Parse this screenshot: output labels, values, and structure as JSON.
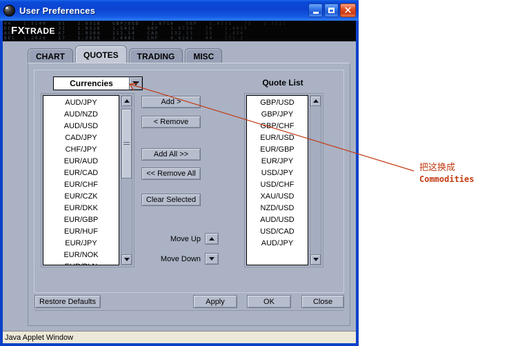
{
  "window": {
    "title": "User Preferences",
    "icon": "app-sphere-icon",
    "buttons": {
      "minimize": "_",
      "maximize": "□",
      "close": "✕"
    }
  },
  "banner": {
    "logo_main": "FX",
    "logo_rest": "TRADE",
    "ticker_noise": "04   1.5140   55   1.0318   GBP/USD   1.8716   GBP   1.6731   73   2.3111\nDEM  1.2140   32   1.0318   1.5416   GBP   1.0736   78   1.4019\nAU   1.2135   67   1.0304   111.14   CAD   132.13   23   1.434\nBEL  1.2026   17   1.2036   1.6401   CHF   0.6161   44   171.2",
    "color": "#050505"
  },
  "tabs": [
    {
      "label": "CHART",
      "active": false
    },
    {
      "label": "QUOTES",
      "active": true
    },
    {
      "label": "TRADING",
      "active": false
    },
    {
      "label": "MISC",
      "active": false
    }
  ],
  "combo": {
    "selected": "Currencies",
    "arrow_icon": "chevron-down-icon"
  },
  "available_list": {
    "items": [
      "AUD/JPY",
      "AUD/NZD",
      "AUD/USD",
      "CAD/JPY",
      "CHF/JPY",
      "EUR/AUD",
      "EUR/CAD",
      "EUR/CHF",
      "EUR/CZK",
      "EUR/DKK",
      "EUR/GBP",
      "EUR/HUF",
      "EUR/JPY",
      "EUR/NOK",
      "EUR/PLN"
    ],
    "scroll": {
      "thumb_top_pct": 2,
      "thumb_height_pct": 47
    }
  },
  "quote_list": {
    "title": "Quote List",
    "items": [
      "GBP/USD",
      "GBP/JPY",
      "GBP/CHF",
      "EUR/USD",
      "EUR/GBP",
      "EUR/JPY",
      "USD/JPY",
      "USD/CHF",
      "XAU/USD",
      "NZD/USD",
      "AUD/USD",
      "USD/CAD",
      "AUD/JPY"
    ],
    "scroll": {
      "thumb_top_pct": 0,
      "thumb_height_pct": 0
    }
  },
  "transfer_buttons": [
    {
      "label": "Add >",
      "name": "add-button"
    },
    {
      "label": "< Remove",
      "name": "remove-button"
    },
    {
      "label": "Add All >>",
      "name": "add-all-button"
    },
    {
      "label": "<< Remove All",
      "name": "remove-all-button"
    },
    {
      "label": "Clear Selected",
      "name": "clear-selected-button"
    }
  ],
  "move_controls": {
    "up_label": "Move Up",
    "down_label": "Move Down",
    "up_icon": "chevron-up-icon",
    "down_icon": "chevron-down-icon"
  },
  "footer": {
    "restore_defaults": "Restore Defaults",
    "apply": "Apply",
    "ok": "OK",
    "close": "Close"
  },
  "statusbar": {
    "text": "Java Applet Window"
  },
  "annotation": {
    "line_color": "#c23a12",
    "chinese": "把这换成",
    "english": "Commodities"
  }
}
